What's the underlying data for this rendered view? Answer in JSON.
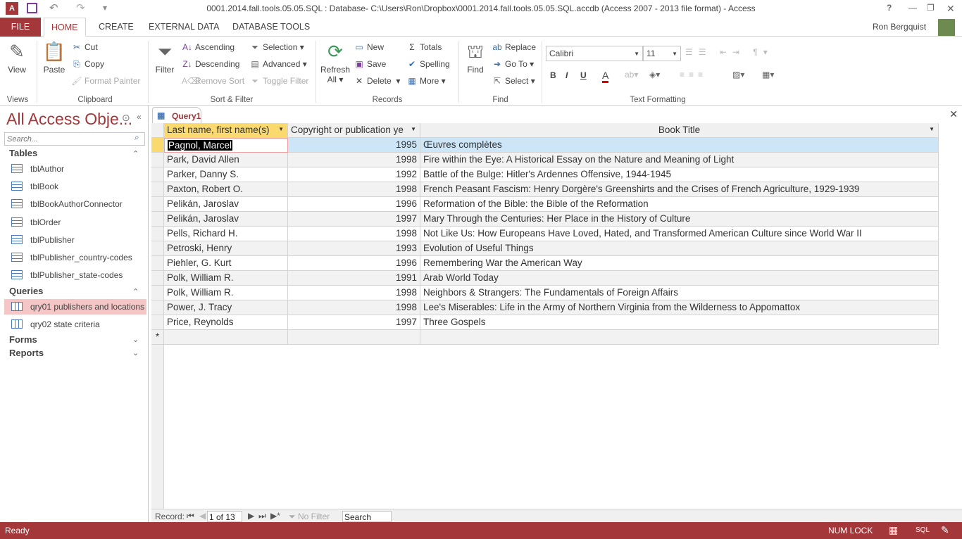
{
  "window": {
    "title": "0001.2014.fall.tools.05.05.SQL : Database- C:\\Users\\Ron\\Dropbox\\0001.2014.fall.tools.05.05.SQL.accdb (Access 2007 - 2013 file format) - Access",
    "user": "Ron Bergquist",
    "help": "?",
    "minimize": "—",
    "restore": "❐",
    "close": "✕"
  },
  "tabs": [
    "FILE",
    "HOME",
    "CREATE",
    "EXTERNAL DATA",
    "DATABASE TOOLS"
  ],
  "ribbon": {
    "views": {
      "view": "View",
      "group": "Views"
    },
    "clipboard": {
      "paste": "Paste",
      "cut": "Cut",
      "copy": "Copy",
      "format_painter": "Format Painter",
      "group": "Clipboard"
    },
    "sort": {
      "filter": "Filter",
      "ascending": "Ascending",
      "descending": "Descending",
      "remove_sort": "Remove Sort",
      "selection": "Selection",
      "advanced": "Advanced",
      "toggle_filter": "Toggle Filter",
      "group": "Sort & Filter"
    },
    "records": {
      "refresh": "Refresh",
      "all": "All",
      "new": "New",
      "save": "Save",
      "delete": "Delete",
      "totals": "Totals",
      "spelling": "Spelling",
      "more": "More",
      "group": "Records"
    },
    "find": {
      "find": "Find",
      "replace": "Replace",
      "goto": "Go To",
      "select": "Select",
      "group": "Find"
    },
    "text": {
      "font": "Calibri",
      "size": "11",
      "bold": "B",
      "italic": "I",
      "underline": "U",
      "group": "Text Formatting"
    }
  },
  "nav": {
    "title": "All Access Obje...",
    "search_placeholder": "Search...",
    "sections": {
      "tables": "Tables",
      "queries": "Queries",
      "forms": "Forms",
      "reports": "Reports"
    },
    "tables": [
      "tblAuthor",
      "tblBook",
      "tblBookAuthorConnector",
      "tblOrder",
      "tblPublisher",
      "tblPublisher_country-codes",
      "tblPublisher_state-codes"
    ],
    "queries": [
      "qry01 publishers and locations",
      "qry02 state criteria"
    ]
  },
  "document": {
    "tab": "Query1",
    "columns": [
      "Last name, first name(s)",
      "Copyright or publication ye",
      "Book Title"
    ],
    "rows": [
      [
        "Pagnol, Marcel",
        "1995",
        "Œuvres complètes"
      ],
      [
        "Park, David Allen",
        "1998",
        "Fire within the Eye: A Historical Essay on the Nature and Meaning of Light"
      ],
      [
        "Parker, Danny S.",
        "1992",
        "Battle of the Bulge: Hitler's Ardennes Offensive, 1944-1945"
      ],
      [
        "Paxton, Robert O.",
        "1998",
        "French Peasant Fascism: Henry Dorgère's Greenshirts and the Crises of French Agriculture, 1929-1939"
      ],
      [
        "Pelikán, Jaroslav",
        "1996",
        "Reformation of the Bible: the Bible of the Reformation"
      ],
      [
        "Pelikán, Jaroslav",
        "1997",
        "Mary Through the Centuries: Her Place in the History of Culture"
      ],
      [
        "Pells, Richard H.",
        "1998",
        "Not Like Us: How Europeans Have Loved, Hated, and Transformed American Culture since World War II"
      ],
      [
        "Petroski, Henry",
        "1993",
        "Evolution of Useful Things"
      ],
      [
        "Piehler, G. Kurt",
        "1996",
        "Remembering War the American Way"
      ],
      [
        "Polk, William R.",
        "1991",
        "Arab World Today"
      ],
      [
        "Polk, William R.",
        "1998",
        "Neighbors & Strangers: The Fundamentals of Foreign Affairs"
      ],
      [
        "Power, J. Tracy",
        "1998",
        "Lee's Miserables: Life in the Army of Northern Virginia from the Wilderness to Appomattox"
      ],
      [
        "Price, Reynolds",
        "1997",
        "Three Gospels"
      ]
    ],
    "new_row_marker": "*"
  },
  "record_nav": {
    "label": "Record:",
    "position": "1 of 13",
    "no_filter": "No Filter",
    "search": "Search"
  },
  "status": {
    "ready": "Ready",
    "numlock": "NUM LOCK",
    "sql": "SQL"
  },
  "colors": {
    "accent": "#A4373A",
    "header_active": "#FADA6E",
    "selected_row": "#CDE6F7"
  }
}
